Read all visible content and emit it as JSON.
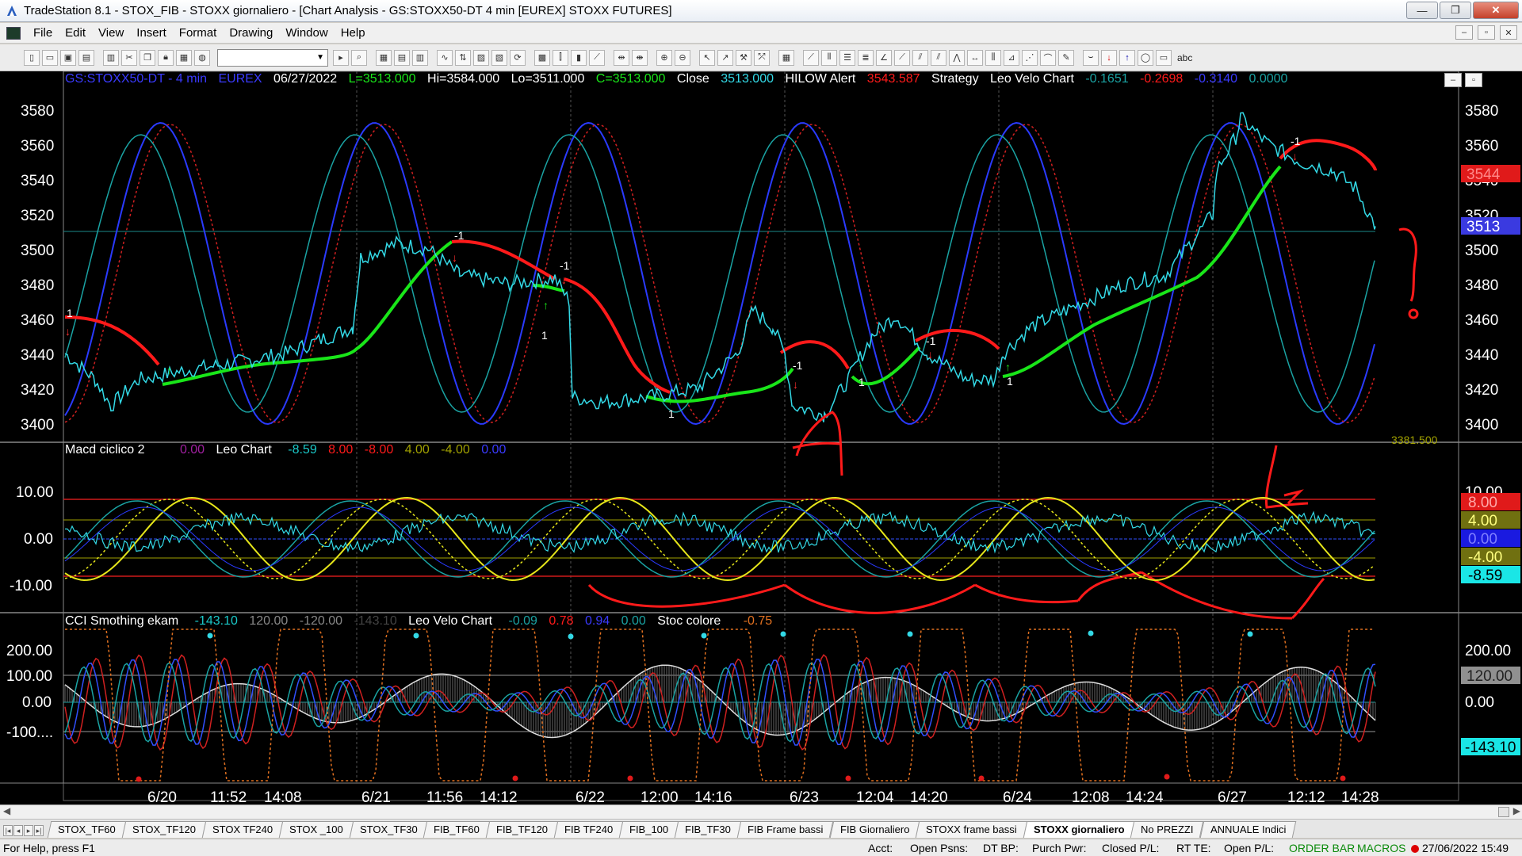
{
  "window": {
    "title": "TradeStation 8.1 - STOX_FIB - STOXX giornaliero - [Chart Analysis - GS:STOXX50-DT  4 min  [EUREX] STOXX FUTURES]",
    "minimize": "—",
    "maximize": "❐",
    "close": "✕"
  },
  "menu": [
    "File",
    "Edit",
    "View",
    "Insert",
    "Format",
    "Drawing",
    "Window",
    "Help"
  ],
  "toolbar": {
    "text_tool_label": "abc"
  },
  "price_header": {
    "symbol": "GS:STOXX50-DT - 4 min",
    "exchange": "EUREX",
    "date": "06/27/2022",
    "last": "L=3513.000",
    "high": "Hi=3584.000",
    "low": "Lo=3511.000",
    "close_eq": "C=3513.000",
    "close_label": "Close",
    "close_val": "3513.000",
    "alert_label": "HILOW Alert",
    "alert_val": "3543.587",
    "strategy_label": "Strategy",
    "velo_label": "Leo Velo Chart",
    "velo_v1": "-0.1651",
    "velo_v2": "-0.2698",
    "velo_v3": "-0.3140",
    "velo_v4": "0.0000"
  },
  "macd_header": {
    "name": "Macd ciclico 2",
    "v0": "0.00",
    "label": "Leo Chart",
    "v1": "-8.59",
    "v2": "8.00",
    "v3": "-8.00",
    "v4": "4.00",
    "v5": "-4.00",
    "v6": "0.00"
  },
  "cci_header": {
    "name": "CCI Smothing ekam",
    "v1": "-143.10",
    "v2": "120.00",
    "v3": "-120.00",
    "v4": "-143.10",
    "velo_label": "Leo Velo Chart",
    "v5": "-0.09",
    "v6": "0.78",
    "v7": "0.94",
    "v8": "0.00",
    "stoc_label": "Stoc colore",
    "v9": "-0.75"
  },
  "price_axis": [
    "3580",
    "3560",
    "3540",
    "3520",
    "3500",
    "3480",
    "3460",
    "3440",
    "3420",
    "3400"
  ],
  "price_badges": {
    "alert": "3544",
    "last": "3513",
    "cut": "3381.500"
  },
  "macd_axis": [
    "10.00",
    "0.00",
    "-10.00"
  ],
  "macd_badges": [
    "8.00",
    "4.00",
    "0.00",
    "-4.00",
    "-8.59"
  ],
  "cci_axis": [
    "200.00",
    "100.00",
    "0.00",
    "-100...."
  ],
  "cci_badges": [
    "120.00",
    "-143.10"
  ],
  "time_axis": [
    "6/20",
    "11:52",
    "14:08",
    "6/21",
    "11:56",
    "14:12",
    "6/22",
    "12:00",
    "14:16",
    "6/23",
    "12:04",
    "14:20",
    "6/24",
    "12:08",
    "14:24",
    "6/27",
    "12:12",
    "14:28"
  ],
  "chart_data": {
    "type": "line",
    "x": [
      "6/20",
      "6/21",
      "6/22",
      "6/23",
      "6/24",
      "6/27"
    ],
    "series": [
      {
        "name": "Close",
        "values": [
          3430,
          3490,
          3410,
          3410,
          3450,
          3513
        ]
      }
    ],
    "ylim": [
      3400,
      3580
    ],
    "grid": false,
    "colors": {
      "price": "#33d9e6",
      "up_trend": "#19e619",
      "down_trend": "#ff1a1a"
    }
  },
  "tabs": [
    "STOX_TF60",
    "STOX_TF120",
    "STOX TF240",
    "STOX _100",
    "STOX_TF30",
    "FIB_TF60",
    "FIB_TF120",
    "FIB TF240",
    "FIB_100",
    "FIB_TF30",
    "FIB Frame bassi",
    "FIB Giornaliero",
    "STOXX frame bassi",
    "STOXX giornaliero",
    "No PREZZI",
    "ANNUALE Indici"
  ],
  "active_tab": "STOXX giornaliero",
  "status": {
    "help": "For Help, press F1",
    "acct": "Acct:",
    "open_psns": "Open Psns:",
    "dt_bp": "DT BP:",
    "purch_pwr": "Purch Pwr:",
    "closed_pl": "Closed P/L:",
    "rt_te": "RT TE:",
    "open_pl": "Open P/L:",
    "order_bar": "ORDER BAR",
    "macros": "MACROS",
    "datetime": "27/06/2022 15:49"
  }
}
